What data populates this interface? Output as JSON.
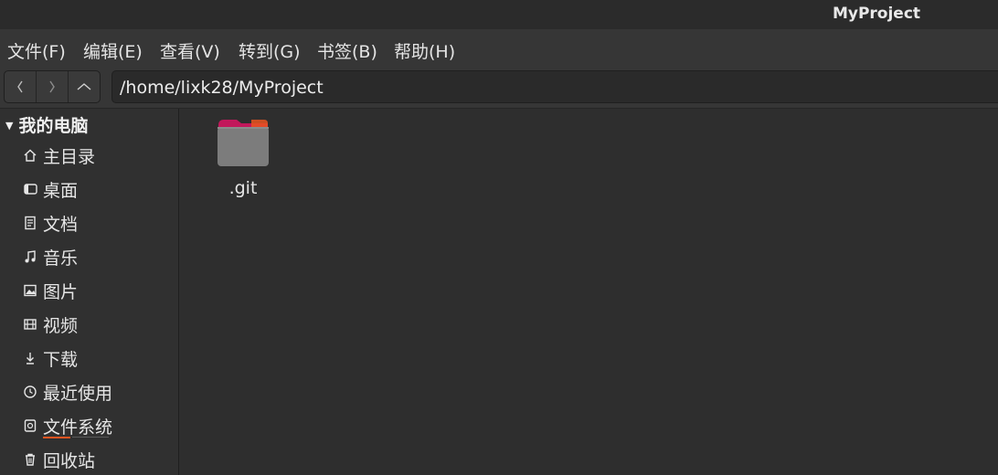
{
  "window": {
    "title": "MyProject"
  },
  "menu": [
    "文件(F)",
    "编辑(E)",
    "查看(V)",
    "转到(G)",
    "书签(B)",
    "帮助(H)"
  ],
  "toolbar": {
    "back_icon": "chevron-left-icon",
    "forward_icon": "chevron-right-icon",
    "up_icon": "chevron-up-icon",
    "path": "/home/lixk28/MyProject"
  },
  "sidebar": {
    "section_label": "我的电脑",
    "items": [
      {
        "label": "主目录",
        "icon": "home-icon"
      },
      {
        "label": "桌面",
        "icon": "desktop-icon"
      },
      {
        "label": "文档",
        "icon": "document-icon"
      },
      {
        "label": "音乐",
        "icon": "music-icon"
      },
      {
        "label": "图片",
        "icon": "picture-icon"
      },
      {
        "label": "视频",
        "icon": "video-icon"
      },
      {
        "label": "下载",
        "icon": "download-icon"
      },
      {
        "label": "最近使用",
        "icon": "clock-icon"
      },
      {
        "label": "文件系统",
        "icon": "drive-icon"
      },
      {
        "label": "回收站",
        "icon": "trash-icon"
      }
    ]
  },
  "files": [
    {
      "name": ".git",
      "icon": "folder-icon"
    }
  ],
  "colors": {
    "accent": "#e95420",
    "folder_tab": "#c2185b"
  }
}
